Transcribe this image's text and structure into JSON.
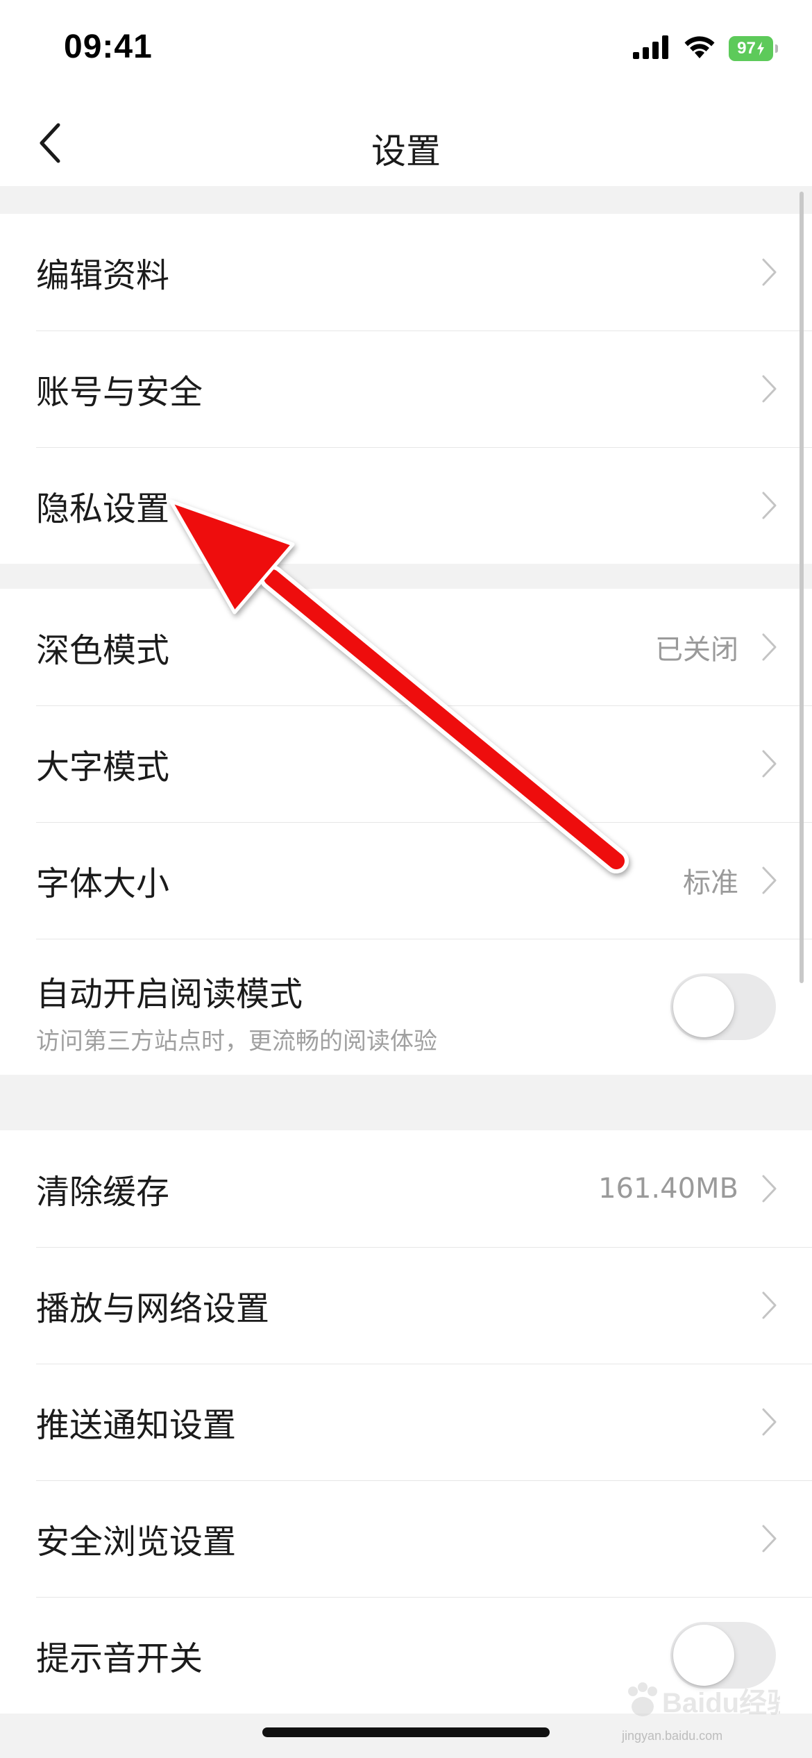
{
  "status_bar": {
    "time": "09:41",
    "battery_level": "97"
  },
  "header": {
    "title": "设置"
  },
  "sections": [
    {
      "items": [
        {
          "label": "编辑资料"
        },
        {
          "label": "账号与安全"
        },
        {
          "label": "隐私设置"
        }
      ]
    },
    {
      "items": [
        {
          "label": "深色模式",
          "value": "已关闭"
        },
        {
          "label": "大字模式"
        },
        {
          "label": "字体大小",
          "value": "标准"
        },
        {
          "label": "自动开启阅读模式",
          "subtitle": "访问第三方站点时，更流畅的阅读体验",
          "toggle": false
        }
      ]
    },
    {
      "items": [
        {
          "label": "清除缓存",
          "value": "161.40MB"
        },
        {
          "label": "播放与网络设置"
        },
        {
          "label": "推送通知设置"
        },
        {
          "label": "安全浏览设置"
        },
        {
          "label": "提示音开关",
          "toggle": false
        }
      ]
    }
  ],
  "watermark": {
    "brand": "Baidu经验",
    "url": "jingyan.baidu.com"
  },
  "colors": {
    "background": "#f2f2f2",
    "surface": "#ffffff",
    "divider": "#e6e6e6",
    "text_primary": "#1b1b1b",
    "text_secondary": "#9a9a9a",
    "battery": "#5dca5a",
    "toggle_off": "#e9e9ea",
    "annotation_arrow": "#ee1111"
  },
  "icons": {
    "back": "chevron-left-icon",
    "row_disclosure": "chevron-right-icon",
    "signal": "cellular-signal-icon",
    "wifi": "wifi-icon",
    "battery": "battery-icon"
  }
}
